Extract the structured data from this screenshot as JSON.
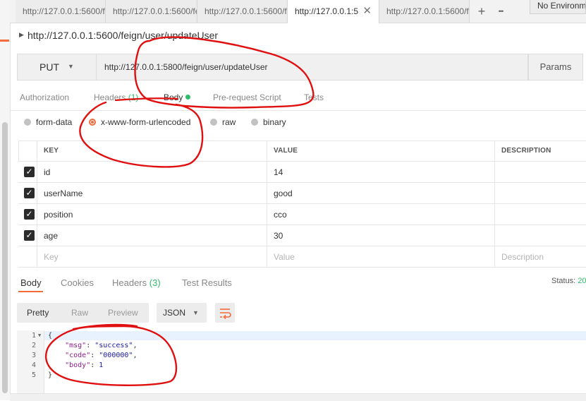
{
  "tabs": [
    {
      "label": "http://127.0.0.1:5600/fe"
    },
    {
      "label": "http://127.0.0.1:5600/fe"
    },
    {
      "label": "http://127.0.0.1:5600/fe"
    },
    {
      "label": "http://127.0.0.1:5",
      "close": "✕"
    },
    {
      "label": "http://127.0.0.1:5600/fe"
    }
  ],
  "tab_actions": {
    "add": "+",
    "more": "•••"
  },
  "environment": "No Environm",
  "request": {
    "name": "http://127.0.0.1:5600/feign/user/updateUser",
    "method": "PUT",
    "url": "http://127.0.0.1:5800/feign/user/updateUser",
    "params_label": "Params"
  },
  "request_tabs": {
    "authorization": "Authorization",
    "headers": "Headers",
    "headers_count": "(1)",
    "body": "Body",
    "prerequest": "Pre-request Script",
    "tests": "Tests"
  },
  "body_types": {
    "form_data": "form-data",
    "urlencoded": "x-www-form-urlencoded",
    "raw": "raw",
    "binary": "binary",
    "selected": "x-www-form-urlencoded"
  },
  "kv_table": {
    "headers": {
      "key": "KEY",
      "value": "VALUE",
      "description": "DESCRIPTION"
    },
    "rows": [
      {
        "key": "id",
        "value": "14",
        "checked": true
      },
      {
        "key": "userName",
        "value": "good",
        "checked": true
      },
      {
        "key": "position",
        "value": "cco",
        "checked": true
      },
      {
        "key": "age",
        "value": "30",
        "checked": true
      }
    ],
    "placeholder": {
      "key": "Key",
      "value": "Value",
      "description": "Description"
    }
  },
  "response_tabs": {
    "body": "Body",
    "cookies": "Cookies",
    "headers": "Headers",
    "headers_count": "(3)",
    "test_results": "Test Results"
  },
  "status": {
    "label": "Status:",
    "value": "20"
  },
  "view_modes": {
    "pretty": "Pretty",
    "raw": "Raw",
    "preview": "Preview"
  },
  "format": "JSON",
  "code": {
    "line_numbers": [
      "1",
      "2",
      "3",
      "4",
      "5"
    ],
    "open": "{",
    "close": "}",
    "msg_key": "\"msg\"",
    "msg_val": "\"success\"",
    "code_key": "\"code\"",
    "code_val": "\"000000\"",
    "body_key": "\"body\"",
    "body_val": "1"
  },
  "colors": {
    "accent": "#f26b3a",
    "green": "#2ebd6b",
    "annotation": "#e01010"
  }
}
